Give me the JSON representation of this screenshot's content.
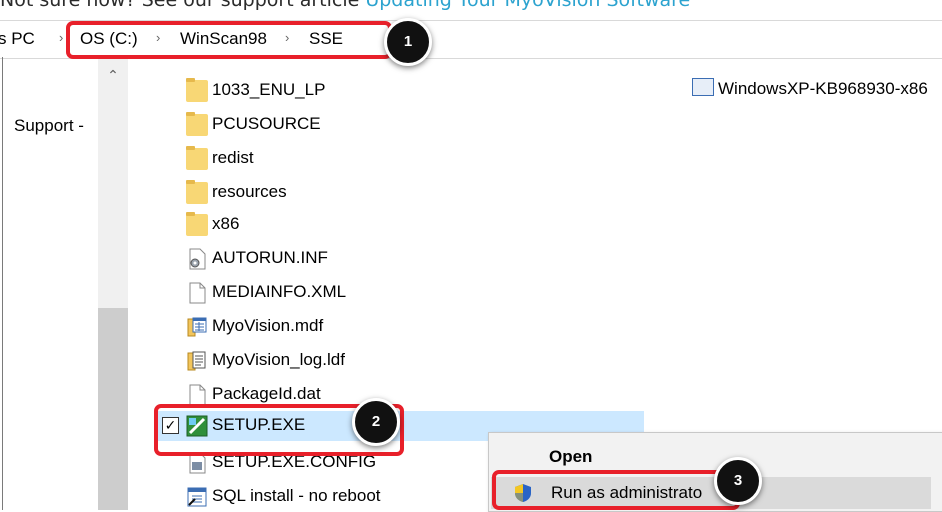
{
  "article": {
    "text_before_link": "Not sure how? See our support article ",
    "link_text": "Updating Your MyoVision Software"
  },
  "address_bar": {
    "crumbs": [
      "s PC",
      "OS (C:)",
      "WinScan98",
      "SSE"
    ],
    "separator": "›"
  },
  "nav_pane": {
    "visible_item": "Support -",
    "scroll_up_glyph": "⌃"
  },
  "files": [
    {
      "name": "1033_ENU_LP",
      "icon": "folder-icon"
    },
    {
      "name": "PCUSOURCE",
      "icon": "folder-icon"
    },
    {
      "name": "redist",
      "icon": "folder-icon"
    },
    {
      "name": "resources",
      "icon": "folder-icon"
    },
    {
      "name": "x86",
      "icon": "folder-icon"
    },
    {
      "name": "AUTORUN.INF",
      "icon": "settings-file-icon"
    },
    {
      "name": "MEDIAINFO.XML",
      "icon": "blank-file-icon"
    },
    {
      "name": "MyoVision.mdf",
      "icon": "database-file-icon"
    },
    {
      "name": "MyoVision_log.ldf",
      "icon": "database-log-icon"
    },
    {
      "name": "PackageId.dat",
      "icon": "blank-file-icon"
    },
    {
      "name": "SETUP.EXE",
      "icon": "setup-exe-icon",
      "selected": true,
      "checked": true
    },
    {
      "name": "SETUP.EXE.CONFIG",
      "icon": "config-file-icon"
    },
    {
      "name": "SQL install - no reboot",
      "icon": "shortcut-icon"
    }
  ],
  "right_column_file": {
    "name": "WindowsXP-KB968930-x86",
    "icon": "update-package-icon"
  },
  "context_menu": {
    "open_label": "Open",
    "run_as_label": "Run as administrato",
    "run_as_icon": "uac-shield-icon"
  },
  "badges": [
    "1",
    "2",
    "3"
  ],
  "colors": {
    "highlight_red": "#e8202a",
    "selection_blue": "#cce8ff",
    "link_blue": "#2ca3cf",
    "badge_black": "#111111"
  }
}
